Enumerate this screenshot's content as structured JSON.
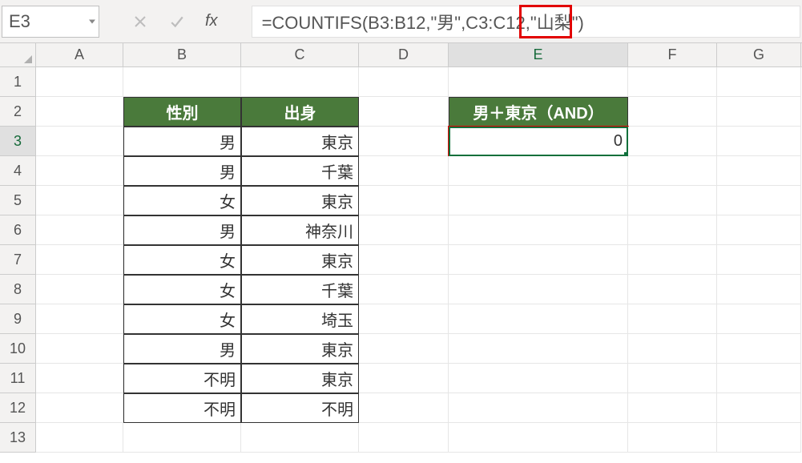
{
  "namebox": {
    "value": "E3"
  },
  "formula_bar": {
    "text": "=COUNTIFS(B3:B12,\"男\",C3:C12,\"山梨\")",
    "highlight_fragment": "\"山梨\""
  },
  "columns": [
    "A",
    "B",
    "C",
    "D",
    "E",
    "F",
    "G"
  ],
  "row_count": 13,
  "active_cell": {
    "row": 3,
    "col": "E"
  },
  "headers": {
    "B2": "性別",
    "C2": "出身",
    "E2": "男＋東京（AND）"
  },
  "data_rows": [
    {
      "B": "男",
      "C": "東京"
    },
    {
      "B": "男",
      "C": "千葉"
    },
    {
      "B": "女",
      "C": "東京"
    },
    {
      "B": "男",
      "C": "神奈川"
    },
    {
      "B": "女",
      "C": "東京"
    },
    {
      "B": "女",
      "C": "千葉"
    },
    {
      "B": "女",
      "C": "埼玉"
    },
    {
      "B": "男",
      "C": "東京"
    },
    {
      "B": "不明",
      "C": "東京"
    },
    {
      "B": "不明",
      "C": "不明"
    }
  ],
  "result_cell": {
    "ref": "E3",
    "value": "0"
  },
  "chart_data": {
    "type": "table",
    "columns": [
      "性別",
      "出身"
    ],
    "rows": [
      [
        "男",
        "東京"
      ],
      [
        "男",
        "千葉"
      ],
      [
        "女",
        "東京"
      ],
      [
        "男",
        "神奈川"
      ],
      [
        "女",
        "東京"
      ],
      [
        "女",
        "千葉"
      ],
      [
        "女",
        "埼玉"
      ],
      [
        "男",
        "東京"
      ],
      [
        "不明",
        "東京"
      ],
      [
        "不明",
        "不明"
      ]
    ],
    "summary": {
      "label": "男＋東京（AND）",
      "formula": "COUNTIFS(B3:B12,\"男\",C3:C12,\"山梨\")",
      "result": 0
    }
  }
}
